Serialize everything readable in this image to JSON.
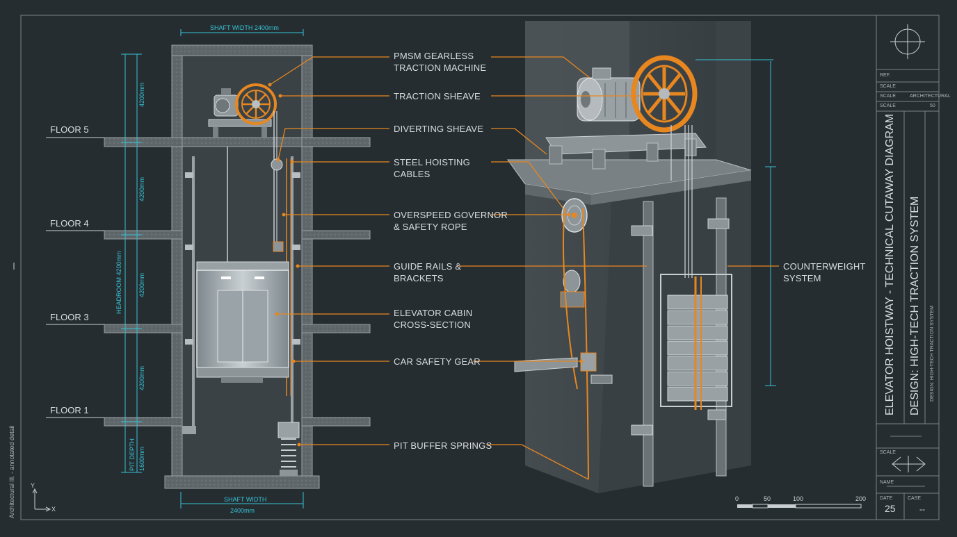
{
  "dimensions": {
    "shaft_width_top": "SHAFT WIDTH 2400mm",
    "shaft_width_bottom_label": "SHAFT WIDTH",
    "shaft_width_bottom_value": "2400mm",
    "overhead_upper": "4200mm",
    "floor_height_upper": "4200mm",
    "headroom": "HEADROOM 4200mm",
    "floor_height_mid": "4200mm",
    "floor_height_lower": "4200mm",
    "pit_depth_label": "PIT DEPTH",
    "pit_depth_value": "1600mm"
  },
  "floors": [
    "FLOOR 5",
    "FLOOR 4",
    "FLOOR 3",
    "FLOOR 1"
  ],
  "callouts": {
    "pmsm": [
      "PMSM GEARLESS",
      "TRACTION MACHINE"
    ],
    "sheave": [
      "TRACTION SHEAVE"
    ],
    "diverting": [
      "DIVERTING SHEAVE"
    ],
    "cables": [
      "STEEL HOISTING",
      "CABLES"
    ],
    "governor": [
      "OVERSPEED GOVERNOR",
      "& SAFETY ROPE"
    ],
    "rails": [
      "GUIDE RAILS &",
      "BRACKETS"
    ],
    "cabin": [
      "ELEVATOR CABIN",
      "CROSS-SECTION"
    ],
    "safety": [
      "CAR SAFETY GEAR"
    ],
    "buffer": [
      "PIT BUFFER SPRINGS"
    ],
    "counterweight": [
      "COUNTERWEIGHT",
      "SYSTEM"
    ]
  },
  "scale_bar": {
    "ticks": [
      "0",
      "50",
      "100",
      "200"
    ]
  },
  "axes": {
    "y": "Y",
    "x": "X"
  },
  "side_note": "Architectural Ill. - annotated detail",
  "title_block": {
    "title": "ELEVATOR HOISTWAY - TECHNICAL CUTAWAY DIAGRAM",
    "design": "DESIGN: HIGH-TECH TRACTION SYSTEM",
    "design_small": "DESIGN: HIGH-TECH TRACTION SYSTEM",
    "rows": [
      {
        "label": "REF.",
        "value": ""
      },
      {
        "label": "SCALE",
        "value": ""
      },
      {
        "label": "SCALE",
        "value": "ARCHITECTURAL"
      },
      {
        "label": "SCALE",
        "value": "50"
      }
    ],
    "scale_label": "SCALE",
    "name_label": "NAME",
    "date_label": "DATE",
    "date_value": "25",
    "case_label": "CASE",
    "case_value": "--"
  },
  "colors": {
    "background": "#262d31",
    "concrete": "#6e7579",
    "accent_orange": "#e8871f",
    "dimension_cyan": "#36c3d6",
    "linework": "#c9ced1"
  }
}
